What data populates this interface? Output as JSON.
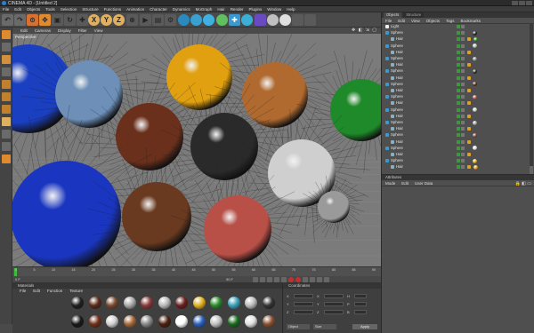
{
  "window": {
    "title": "CINEMA 4D - [Untitled 2]"
  },
  "menubar": {
    "items": [
      "File",
      "Edit",
      "Objects",
      "Tools",
      "Selection",
      "Structure",
      "Functions",
      "Animation",
      "Character",
      "Dynamics",
      "MoGraph",
      "Hair",
      "Render",
      "Plugins",
      "Window",
      "Help"
    ]
  },
  "toolbar": {
    "axis_x": "X",
    "axis_y": "Y",
    "axis_z": "Z"
  },
  "viewport": {
    "menu": [
      "Edit",
      "Cameras",
      "Display",
      "Filter",
      "View"
    ],
    "label": "Perspective",
    "nav_icons": "✥ ◧ ⇲ ▢"
  },
  "timeline": {
    "ticks": [
      "0",
      "5",
      "10",
      "15",
      "20",
      "25",
      "30",
      "35",
      "40",
      "45",
      "50",
      "55",
      "60",
      "65",
      "70",
      "75",
      "80",
      "85",
      "90"
    ],
    "start_frame": "0 F",
    "end_frame": "90 F"
  },
  "material_manager": {
    "title": "Materials",
    "menu": [
      "File",
      "Edit",
      "Function",
      "Texture"
    ],
    "swatch_colors": [
      "#202020",
      "#5c2a1a",
      "#7a4a30",
      "#a8a8a8",
      "#8c3a3a",
      "#b8b8b8",
      "#6a2020",
      "#e0b020",
      "#2a8a2a",
      "#3aa0b8",
      "#bbbbbb",
      "#333333",
      "#1a1a1a",
      "#703018",
      "#d0d0d0",
      "#a86838",
      "#888888",
      "#4a2010",
      "#ffffff",
      "#2a60c0",
      "#c0c0c0",
      "#1a6a20",
      "#e0e0e0",
      "#8a5030"
    ]
  },
  "coordinates": {
    "title": "Coordinates",
    "fields": [
      "X",
      "Y",
      "Z"
    ],
    "mode_option": "Object",
    "size_option": "Size",
    "apply_label": "Apply"
  },
  "object_manager": {
    "tabs": [
      "Objects",
      "Structure"
    ],
    "menu": [
      "File",
      "Edit",
      "View",
      "Objects",
      "Tags",
      "Bookmarks"
    ],
    "rows": [
      {
        "name": "Light",
        "indent": 0,
        "icon": "light",
        "mat": ""
      },
      {
        "name": "Sphere",
        "indent": 0,
        "icon": "sphere",
        "mat": "#222222"
      },
      {
        "name": "Hair",
        "indent": 1,
        "icon": "hair",
        "mat": "#2a8a2a"
      },
      {
        "name": "Sphere",
        "indent": 0,
        "icon": "sphere",
        "mat": "#c0c0c0"
      },
      {
        "name": "Hair",
        "indent": 1,
        "icon": "hair",
        "mat": ""
      },
      {
        "name": "Sphere",
        "indent": 0,
        "icon": "sphere",
        "mat": "#888888"
      },
      {
        "name": "Hair",
        "indent": 1,
        "icon": "hair",
        "mat": ""
      },
      {
        "name": "Sphere",
        "indent": 0,
        "icon": "sphere",
        "mat": "#2a2a2a"
      },
      {
        "name": "Hair",
        "indent": 1,
        "icon": "hair",
        "mat": ""
      },
      {
        "name": "Sphere",
        "indent": 0,
        "icon": "sphere",
        "mat": "#5c2a1a"
      },
      {
        "name": "Hair",
        "indent": 1,
        "icon": "hair",
        "mat": ""
      },
      {
        "name": "Sphere",
        "indent": 0,
        "icon": "sphere",
        "mat": "#b85a5a"
      },
      {
        "name": "Hair",
        "indent": 1,
        "icon": "hair",
        "mat": ""
      },
      {
        "name": "Sphere",
        "indent": 0,
        "icon": "sphere",
        "mat": "#d0d0d0"
      },
      {
        "name": "Hair",
        "indent": 1,
        "icon": "hair",
        "mat": ""
      },
      {
        "name": "Sphere",
        "indent": 0,
        "icon": "sphere",
        "mat": "#aaaaaa"
      },
      {
        "name": "Hair",
        "indent": 1,
        "icon": "hair",
        "mat": ""
      },
      {
        "name": "Sphere",
        "indent": 0,
        "icon": "sphere",
        "mat": "#7a4a30"
      },
      {
        "name": "Hair",
        "indent": 1,
        "icon": "hair",
        "mat": ""
      },
      {
        "name": "Sphere",
        "indent": 0,
        "icon": "sphere",
        "mat": "#e0e0e0"
      },
      {
        "name": "Hair",
        "indent": 1,
        "icon": "hair",
        "mat": ""
      },
      {
        "name": "Sphere",
        "indent": 0,
        "icon": "sphere",
        "mat": "#e0b020"
      },
      {
        "name": "Hair",
        "indent": 1,
        "icon": "hair",
        "mat": "#e0a020"
      }
    ]
  },
  "attribute_manager": {
    "title": "Attributes",
    "menu": [
      "Mode",
      "Edit",
      "User Data"
    ],
    "icons": "🔒 ◧ ▭"
  },
  "spheres": [
    {
      "name": "blue-large",
      "color": "#1a3fc0"
    },
    {
      "name": "blue-marble",
      "color": "#6d8fb8"
    },
    {
      "name": "gold",
      "color": "#e0a010"
    },
    {
      "name": "wood-orange",
      "color": "#b06a30"
    },
    {
      "name": "green",
      "color": "#1f8a2a"
    },
    {
      "name": "brown-gloss",
      "color": "#6a301c"
    },
    {
      "name": "black-metal",
      "color": "#2a2a2a"
    },
    {
      "name": "silver",
      "color": "#cfcfcf"
    },
    {
      "name": "blue-bottom",
      "color": "#1a36c0"
    },
    {
      "name": "rocky-brown",
      "color": "#6a3a20"
    },
    {
      "name": "red-clay",
      "color": "#b85048"
    },
    {
      "name": "grey-small",
      "color": "#9a9a9a"
    }
  ]
}
